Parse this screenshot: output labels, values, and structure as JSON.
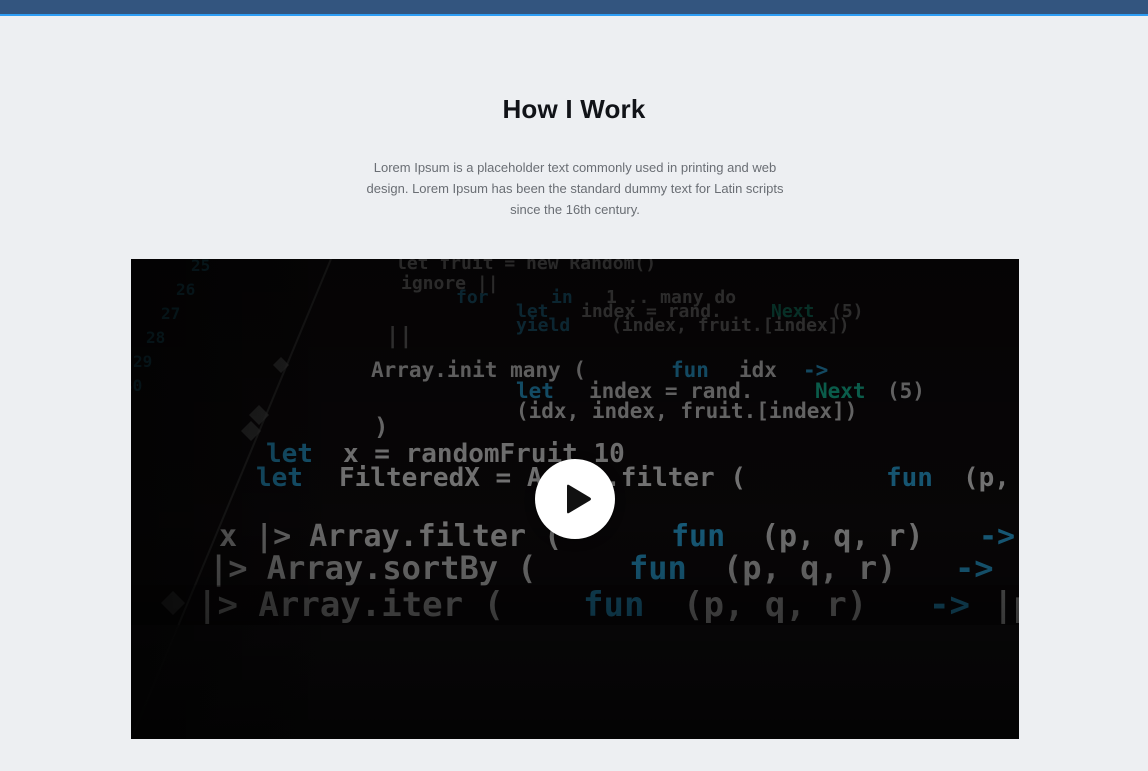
{
  "section": {
    "title": "How I Work",
    "description": "Lorem Ipsum is a placeholder text commonly used in printing and web design. Lorem Ipsum has been the standard dummy text for Latin scripts since the 16th century."
  },
  "video": {
    "play_icon": "play-icon",
    "code_lines": [
      "let x = randomFruit 10",
      "let FilteredX = Array.filter (fun (p,",
      "x |> Array.filter (fun (p, q, r) ->",
      "|> Array.sortBy (fun (p, q, r) ->",
      "|> Array.iter (fun (p, q, r) ->|p",
      "Array.init many (fun idx ->",
      "let index = rand.Next(5)",
      "(idx, index, fruit.[index])",
      "yield (index, fruit.[index])",
      "let index = rand.Next(5)"
    ]
  },
  "colors": {
    "topbar": "#33557f",
    "topbar_accent": "#2e9df4",
    "background": "#edeff2",
    "code_keyword": "#2aa3d8",
    "code_text": "#d8d8d8",
    "code_accent": "#17c7a0"
  }
}
